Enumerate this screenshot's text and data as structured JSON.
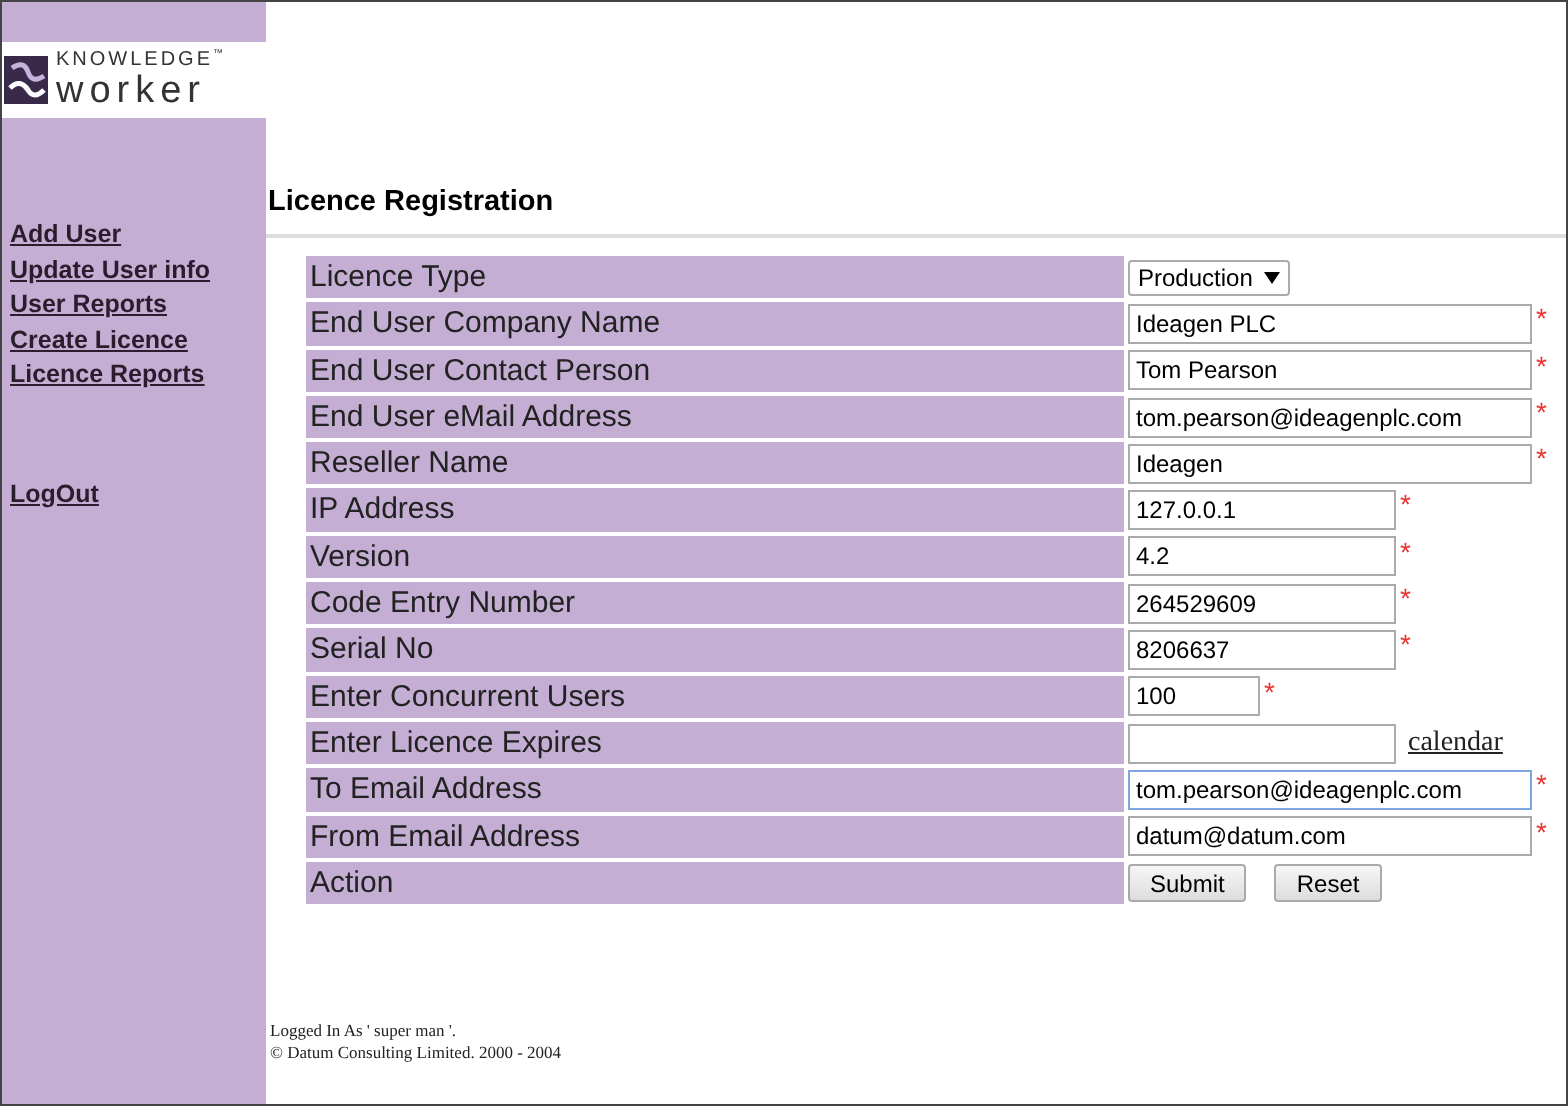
{
  "logo": {
    "top": "KNOWLEDGE",
    "tm": "™",
    "bottom": "worker"
  },
  "nav": [
    "Add User",
    "Update User info",
    "User Reports",
    "Create Licence",
    "Licence Reports"
  ],
  "logout": "LogOut",
  "heading": "Licence Registration",
  "rows": [
    {
      "label": "Licence Type",
      "kind": "select",
      "value": "Production",
      "required": false
    },
    {
      "label": "End User Company Name",
      "kind": "long_text",
      "value": "Ideagen PLC",
      "required": true,
      "focused": false
    },
    {
      "label": "End User Contact Person",
      "kind": "long_text",
      "value": "Tom Pearson",
      "required": true,
      "focused": false
    },
    {
      "label": "End User eMail Address",
      "kind": "long_text",
      "value": "tom.pearson@ideagenplc.com",
      "required": true,
      "focused": false
    },
    {
      "label": "Reseller Name",
      "kind": "long_text",
      "value": "Ideagen",
      "required": true,
      "focused": false
    },
    {
      "label": "IP Address",
      "kind": "medium_text",
      "value": "127.0.0.1",
      "required": true,
      "focused": false
    },
    {
      "label": "Version",
      "kind": "medium_text",
      "value": "4.2",
      "required": true,
      "focused": false
    },
    {
      "label": "Code Entry Number",
      "kind": "medium_text",
      "value": "264529609",
      "required": true,
      "focused": false
    },
    {
      "label": "Serial No",
      "kind": "medium_text",
      "value": "8206637",
      "required": true,
      "focused": false
    },
    {
      "label": "Enter Concurrent Users",
      "kind": "short_text",
      "value": "100",
      "required": true,
      "focused": false
    },
    {
      "label": "Enter Licence Expires",
      "kind": "date",
      "link": "calendar",
      "required": false,
      "focused": false
    },
    {
      "label": "To Email Address",
      "kind": "long_text",
      "value": "tom.pearson@ideagenplc.com",
      "required": true,
      "focused": true
    },
    {
      "label": "From Email Address",
      "kind": "long_text",
      "value": "datum@datum.com",
      "required": true,
      "focused": false
    },
    {
      "label": "Action",
      "kind": "buttons",
      "buttons": [
        "Submit",
        "Reset"
      ],
      "required": false
    }
  ],
  "required_mark": "*",
  "footer": {
    "logged_in": "Logged In As ' super man '.",
    "copyright": "© Datum Consulting Limited. 2000 - 2004"
  }
}
